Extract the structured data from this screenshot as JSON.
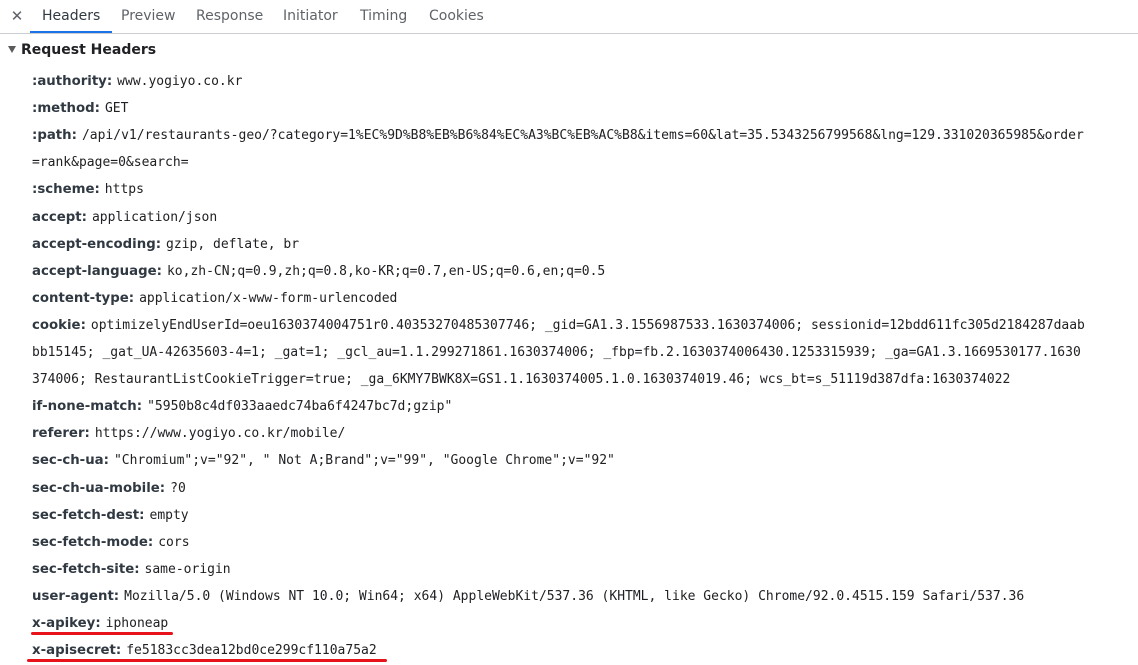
{
  "tabs": {
    "close": "✕",
    "headers": "Headers",
    "preview": "Preview",
    "response": "Response",
    "initiator": "Initiator",
    "timing": "Timing",
    "cookies": "Cookies"
  },
  "section": {
    "title": "Request Headers"
  },
  "headers": [
    {
      "name": ":authority:",
      "value": "www.yogiyo.co.kr"
    },
    {
      "name": ":method:",
      "value": "GET"
    },
    {
      "name": ":path:",
      "value": "/api/v1/restaurants-geo/?category=1%EC%9D%B8%EB%B6%84%EC%A3%BC%EB%AC%B8&items=60&lat=35.5343256799568&lng=129.331020365985&order",
      "cont": [
        "=rank&page=0&search="
      ]
    },
    {
      "name": ":scheme:",
      "value": "https"
    },
    {
      "name": "accept:",
      "value": "application/json"
    },
    {
      "name": "accept-encoding:",
      "value": "gzip, deflate, br"
    },
    {
      "name": "accept-language:",
      "value": "ko,zh-CN;q=0.9,zh;q=0.8,ko-KR;q=0.7,en-US;q=0.6,en;q=0.5"
    },
    {
      "name": "content-type:",
      "value": "application/x-www-form-urlencoded"
    },
    {
      "name": "cookie:",
      "value": "optimizelyEndUserId=oeu1630374004751r0.40353270485307746; _gid=GA1.3.1556987533.1630374006; sessionid=12bdd611fc305d2184287daab",
      "cont": [
        "bb15145; _gat_UA-42635603-4=1; _gat=1; _gcl_au=1.1.299271861.1630374006; _fbp=fb.2.1630374006430.1253315939; _ga=GA1.3.1669530177.1630",
        "374006; RestaurantListCookieTrigger=true; _ga_6KMY7BWK8X=GS1.1.1630374005.1.0.1630374019.46; wcs_bt=s_51119d387dfa:1630374022"
      ]
    },
    {
      "name": "if-none-match:",
      "value": "\"5950b8c4df033aaedc74ba6f4247bc7d;gzip\""
    },
    {
      "name": "referer:",
      "value": "https://www.yogiyo.co.kr/mobile/"
    },
    {
      "name": "sec-ch-ua:",
      "value": "\"Chromium\";v=\"92\", \" Not A;Brand\";v=\"99\", \"Google Chrome\";v=\"92\""
    },
    {
      "name": "sec-ch-ua-mobile:",
      "value": "?0"
    },
    {
      "name": "sec-fetch-dest:",
      "value": "empty"
    },
    {
      "name": "sec-fetch-mode:",
      "value": "cors"
    },
    {
      "name": "sec-fetch-site:",
      "value": "same-origin"
    },
    {
      "name": "user-agent:",
      "value": "Mozilla/5.0 (Windows NT 10.0; Win64; x64) AppleWebKit/537.36 (KHTML, like Gecko) Chrome/92.0.4515.159 Safari/537.36"
    },
    {
      "name": "x-apikey:",
      "value": "iphoneap"
    },
    {
      "name": "x-apisecret:",
      "value": "fe5183cc3dea12bd0ce299cf110a75a2"
    }
  ],
  "colors": {
    "accent": "#1a73e8",
    "annotation": "#e8131a"
  }
}
